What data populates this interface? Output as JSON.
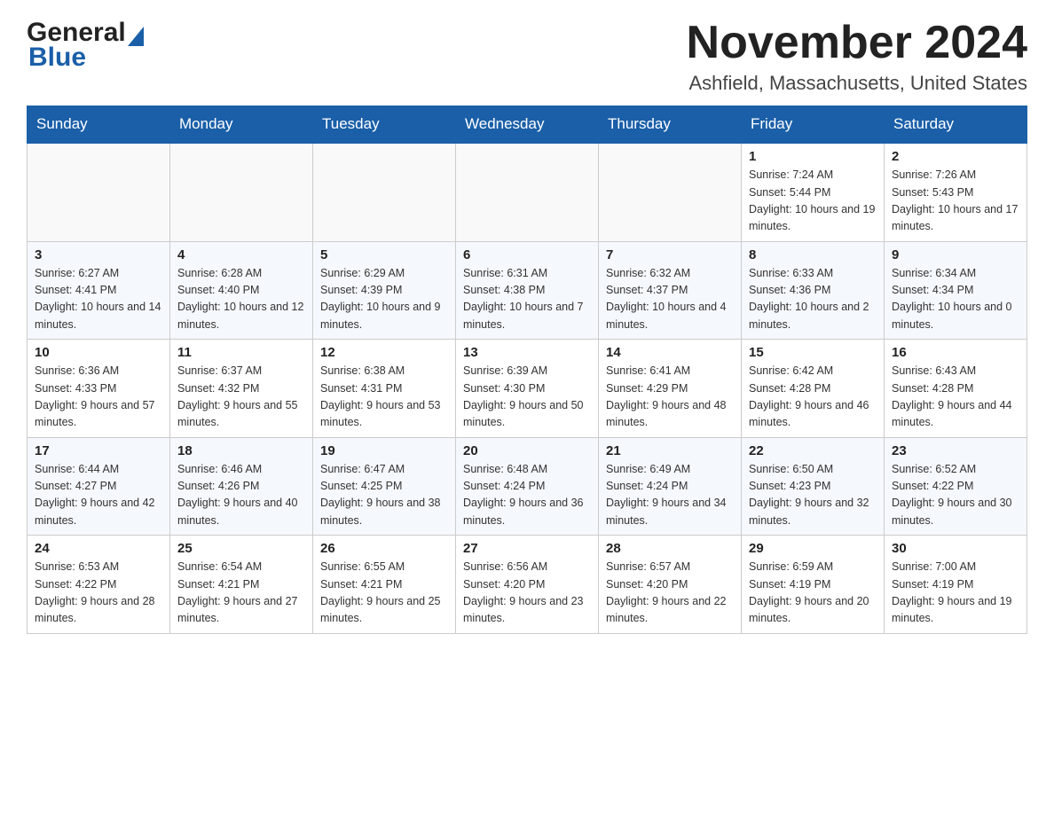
{
  "header": {
    "logo_general": "General",
    "logo_blue": "Blue",
    "title": "November 2024",
    "location": "Ashfield, Massachusetts, United States"
  },
  "weekdays": [
    "Sunday",
    "Monday",
    "Tuesday",
    "Wednesday",
    "Thursday",
    "Friday",
    "Saturday"
  ],
  "weeks": [
    [
      {
        "day": "",
        "info": ""
      },
      {
        "day": "",
        "info": ""
      },
      {
        "day": "",
        "info": ""
      },
      {
        "day": "",
        "info": ""
      },
      {
        "day": "",
        "info": ""
      },
      {
        "day": "1",
        "info": "Sunrise: 7:24 AM\nSunset: 5:44 PM\nDaylight: 10 hours and 19 minutes."
      },
      {
        "day": "2",
        "info": "Sunrise: 7:26 AM\nSunset: 5:43 PM\nDaylight: 10 hours and 17 minutes."
      }
    ],
    [
      {
        "day": "3",
        "info": "Sunrise: 6:27 AM\nSunset: 4:41 PM\nDaylight: 10 hours and 14 minutes."
      },
      {
        "day": "4",
        "info": "Sunrise: 6:28 AM\nSunset: 4:40 PM\nDaylight: 10 hours and 12 minutes."
      },
      {
        "day": "5",
        "info": "Sunrise: 6:29 AM\nSunset: 4:39 PM\nDaylight: 10 hours and 9 minutes."
      },
      {
        "day": "6",
        "info": "Sunrise: 6:31 AM\nSunset: 4:38 PM\nDaylight: 10 hours and 7 minutes."
      },
      {
        "day": "7",
        "info": "Sunrise: 6:32 AM\nSunset: 4:37 PM\nDaylight: 10 hours and 4 minutes."
      },
      {
        "day": "8",
        "info": "Sunrise: 6:33 AM\nSunset: 4:36 PM\nDaylight: 10 hours and 2 minutes."
      },
      {
        "day": "9",
        "info": "Sunrise: 6:34 AM\nSunset: 4:34 PM\nDaylight: 10 hours and 0 minutes."
      }
    ],
    [
      {
        "day": "10",
        "info": "Sunrise: 6:36 AM\nSunset: 4:33 PM\nDaylight: 9 hours and 57 minutes."
      },
      {
        "day": "11",
        "info": "Sunrise: 6:37 AM\nSunset: 4:32 PM\nDaylight: 9 hours and 55 minutes."
      },
      {
        "day": "12",
        "info": "Sunrise: 6:38 AM\nSunset: 4:31 PM\nDaylight: 9 hours and 53 minutes."
      },
      {
        "day": "13",
        "info": "Sunrise: 6:39 AM\nSunset: 4:30 PM\nDaylight: 9 hours and 50 minutes."
      },
      {
        "day": "14",
        "info": "Sunrise: 6:41 AM\nSunset: 4:29 PM\nDaylight: 9 hours and 48 minutes."
      },
      {
        "day": "15",
        "info": "Sunrise: 6:42 AM\nSunset: 4:28 PM\nDaylight: 9 hours and 46 minutes."
      },
      {
        "day": "16",
        "info": "Sunrise: 6:43 AM\nSunset: 4:28 PM\nDaylight: 9 hours and 44 minutes."
      }
    ],
    [
      {
        "day": "17",
        "info": "Sunrise: 6:44 AM\nSunset: 4:27 PM\nDaylight: 9 hours and 42 minutes."
      },
      {
        "day": "18",
        "info": "Sunrise: 6:46 AM\nSunset: 4:26 PM\nDaylight: 9 hours and 40 minutes."
      },
      {
        "day": "19",
        "info": "Sunrise: 6:47 AM\nSunset: 4:25 PM\nDaylight: 9 hours and 38 minutes."
      },
      {
        "day": "20",
        "info": "Sunrise: 6:48 AM\nSunset: 4:24 PM\nDaylight: 9 hours and 36 minutes."
      },
      {
        "day": "21",
        "info": "Sunrise: 6:49 AM\nSunset: 4:24 PM\nDaylight: 9 hours and 34 minutes."
      },
      {
        "day": "22",
        "info": "Sunrise: 6:50 AM\nSunset: 4:23 PM\nDaylight: 9 hours and 32 minutes."
      },
      {
        "day": "23",
        "info": "Sunrise: 6:52 AM\nSunset: 4:22 PM\nDaylight: 9 hours and 30 minutes."
      }
    ],
    [
      {
        "day": "24",
        "info": "Sunrise: 6:53 AM\nSunset: 4:22 PM\nDaylight: 9 hours and 28 minutes."
      },
      {
        "day": "25",
        "info": "Sunrise: 6:54 AM\nSunset: 4:21 PM\nDaylight: 9 hours and 27 minutes."
      },
      {
        "day": "26",
        "info": "Sunrise: 6:55 AM\nSunset: 4:21 PM\nDaylight: 9 hours and 25 minutes."
      },
      {
        "day": "27",
        "info": "Sunrise: 6:56 AM\nSunset: 4:20 PM\nDaylight: 9 hours and 23 minutes."
      },
      {
        "day": "28",
        "info": "Sunrise: 6:57 AM\nSunset: 4:20 PM\nDaylight: 9 hours and 22 minutes."
      },
      {
        "day": "29",
        "info": "Sunrise: 6:59 AM\nSunset: 4:19 PM\nDaylight: 9 hours and 20 minutes."
      },
      {
        "day": "30",
        "info": "Sunrise: 7:00 AM\nSunset: 4:19 PM\nDaylight: 9 hours and 19 minutes."
      }
    ]
  ]
}
